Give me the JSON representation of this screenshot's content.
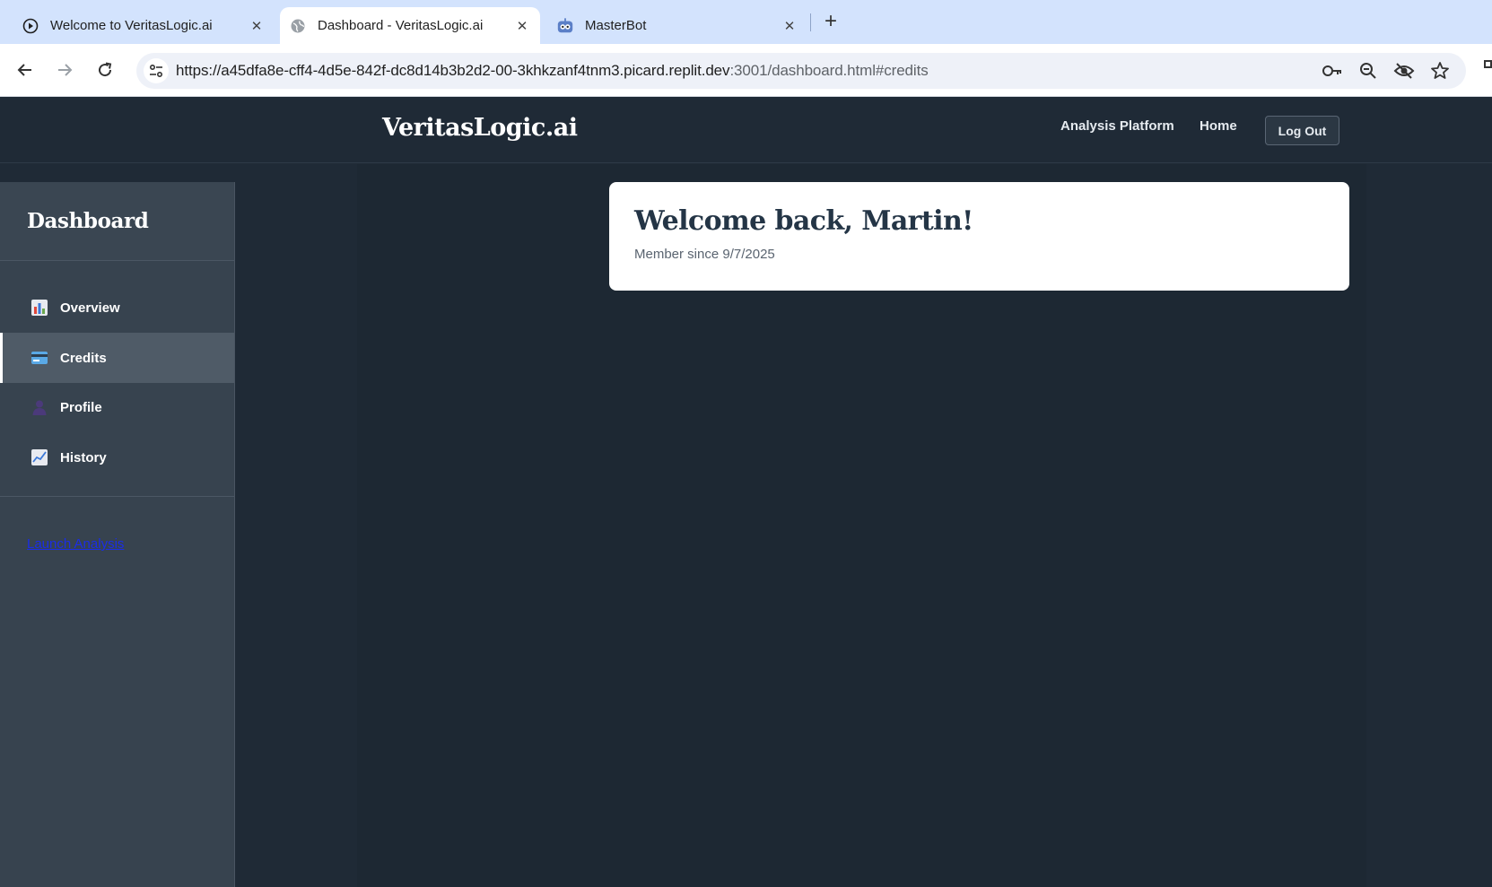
{
  "browser": {
    "tabs": [
      {
        "title": "Welcome to VeritasLogic.ai",
        "icon": "play-circle-icon",
        "active": false
      },
      {
        "title": "Dashboard - VeritasLogic.ai",
        "icon": "globe-icon",
        "active": true
      },
      {
        "title": "MasterBot",
        "icon": "robot-icon",
        "active": false
      }
    ],
    "url_host": "https://a45dfa8e-cff4-4d5e-842f-dc8d14b3b2d2-00-3khkzanf4tnm3.picard.replit.dev",
    "url_rest": ":3001/dashboard.html#credits"
  },
  "header": {
    "brand": "VeritasLogic.ai",
    "nav": [
      "Analysis Platform",
      "Home"
    ],
    "logout_label": "Log Out"
  },
  "sidebar": {
    "title": "Dashboard",
    "items": [
      {
        "label": "Overview",
        "icon": "bar-chart-icon",
        "active": false
      },
      {
        "label": "Credits",
        "icon": "credit-card-icon",
        "active": true
      },
      {
        "label": "Profile",
        "icon": "user-icon",
        "active": false
      },
      {
        "label": "History",
        "icon": "line-chart-icon",
        "active": false
      }
    ],
    "launch_link": "Launch Analysis"
  },
  "welcome": {
    "title": "Welcome back, Martin!",
    "member_since": "Member since 9/7/2025"
  },
  "colors": {
    "page_bg": "#1f2a36",
    "sidebar_bg": "#37434f",
    "sidebar_active": "#4f5b67",
    "card_title": "#243546",
    "link": "#1a2de8",
    "chrome_tab_strip": "#d3e3fd"
  }
}
